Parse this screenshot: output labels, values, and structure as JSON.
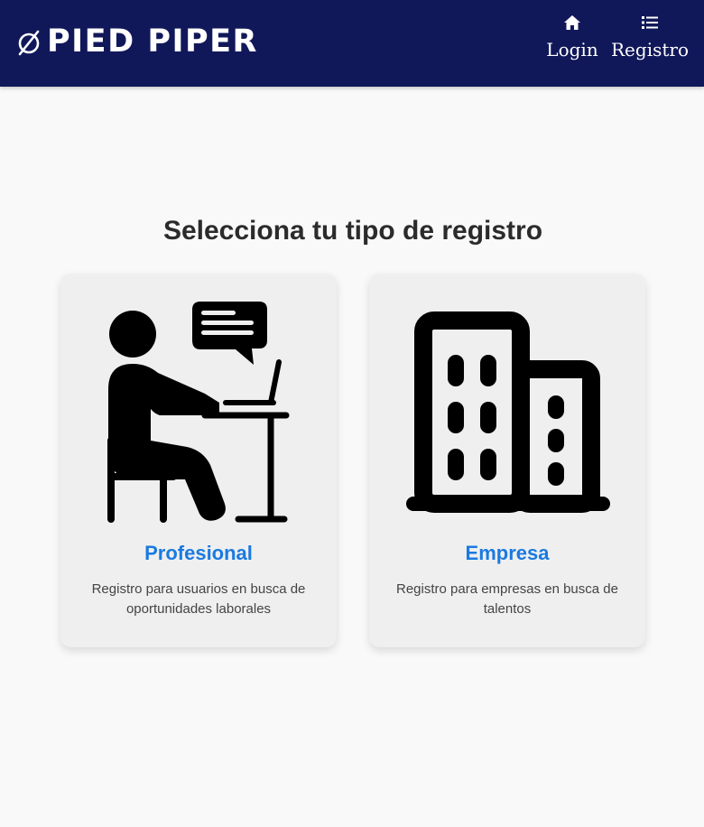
{
  "header": {
    "brand": "PIED PIPER",
    "nav": [
      {
        "label": "Login",
        "icon": "home-icon"
      },
      {
        "label": "Registro",
        "icon": "list-icon"
      }
    ]
  },
  "main": {
    "title": "Selecciona tu tipo de registro",
    "cards": [
      {
        "title": "Profesional",
        "description": "Registro para usuarios en busca de oportunidades laborales",
        "icon": "professional-at-desk-icon"
      },
      {
        "title": "Empresa",
        "description": "Registro para empresas en busca de talentos",
        "icon": "office-building-icon"
      }
    ]
  },
  "colors": {
    "navbar": "#11185a",
    "accent": "#1a7ae0",
    "background": "#f9f9f9",
    "card": "#efefef"
  }
}
